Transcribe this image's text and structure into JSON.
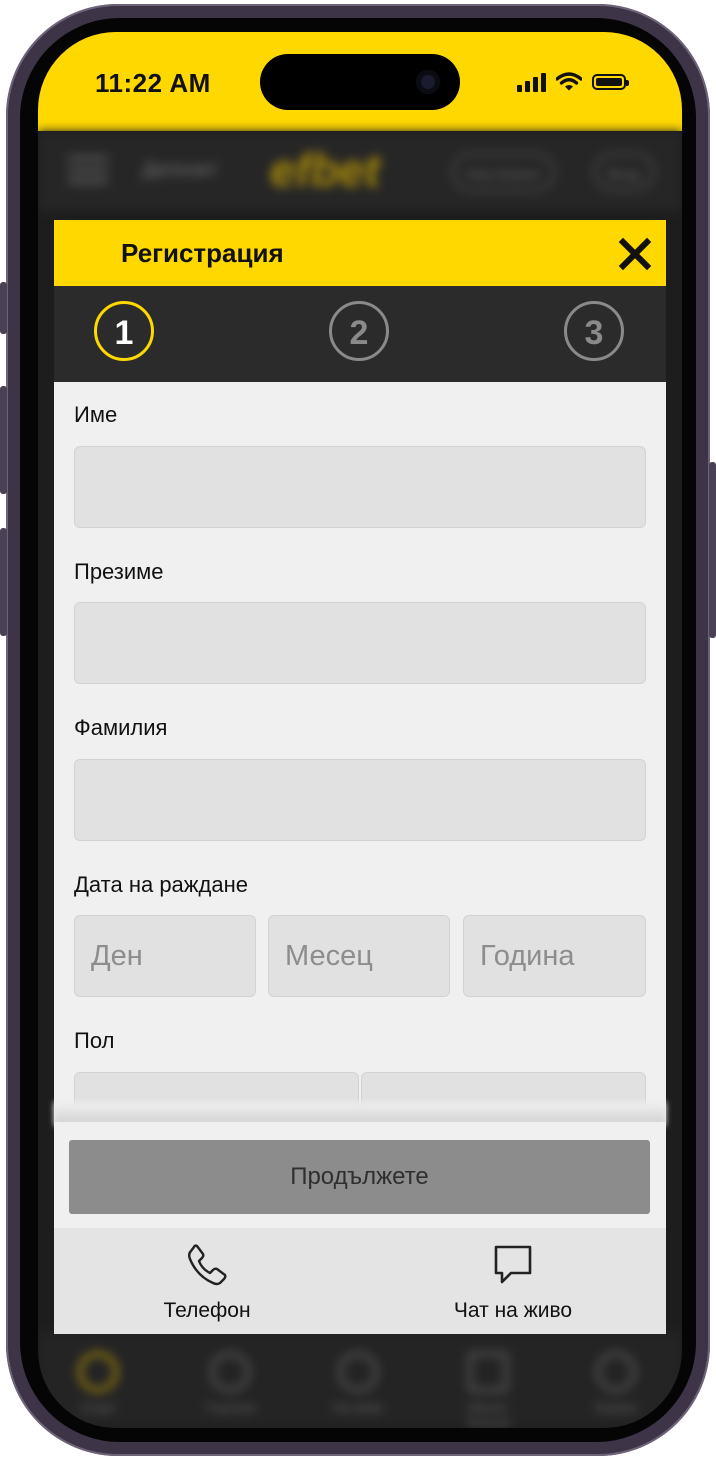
{
  "status_bar": {
    "time": "11:22 AM"
  },
  "background_header": {
    "deposit_label": "Депозит",
    "logo_text": "efbet",
    "new_client_label": "Нов Клиент",
    "login_label": "Вход"
  },
  "background_nav": {
    "items": [
      {
        "label": "Спорт",
        "icon": "sports-ball-icon"
      },
      {
        "label": "Търсене",
        "icon": "search-icon"
      },
      {
        "label": "На живо",
        "icon": "live-icon"
      },
      {
        "label": "Моите Залози",
        "icon": "bets-icon"
      },
      {
        "label": "Казино",
        "icon": "casino-chip-icon"
      }
    ]
  },
  "modal": {
    "title": "Регистрация",
    "close_icon": "close-icon",
    "steps": [
      {
        "number": "1",
        "state": "active"
      },
      {
        "number": "2",
        "state": "inactive"
      },
      {
        "number": "3",
        "state": "inactive"
      }
    ],
    "fields": {
      "first_name_label": "Име",
      "middle_name_label": "Презиме",
      "last_name_label": "Фамилия",
      "birth_date_label": "Дата на раждане",
      "day_value": "Ден",
      "month_value": "Месец",
      "year_value": "Година",
      "gender_label": "Пол"
    },
    "continue_label": "Продължете",
    "contacts": [
      {
        "label": "Телефон",
        "icon": "phone-icon"
      },
      {
        "label": "Чат на живо",
        "icon": "chat-bubble-icon"
      }
    ]
  },
  "colors": {
    "accent": "#ffd800",
    "stepper_bg": "#2b2b2b",
    "form_bg": "#f0f0f0",
    "input_bg": "#e1e1e1",
    "button_disabled": "#8c8c8c"
  }
}
